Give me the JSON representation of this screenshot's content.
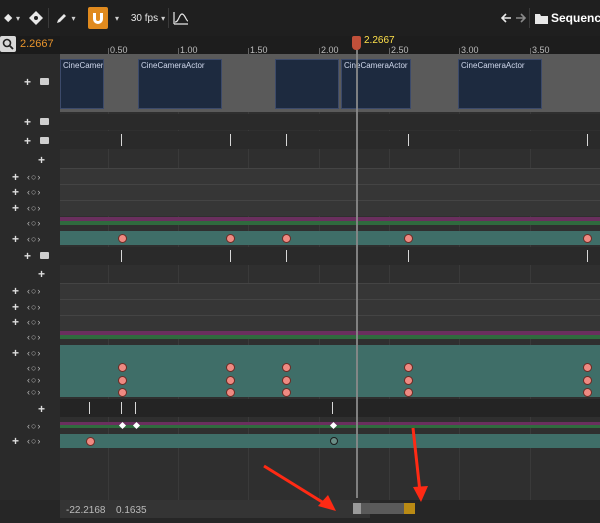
{
  "toolbar": {
    "fps_label": "30 fps",
    "sequence_name": "SequenceM"
  },
  "timeline": {
    "current_time": "2.2667",
    "playhead_time": "2.2667",
    "ticks": [
      "0.50",
      "1.00",
      "1.50",
      "2.00",
      "2.50",
      "3.00",
      "3.50"
    ]
  },
  "camera_clips": [
    "CineCameraActor",
    "CineCameraActor",
    "CineCameraActor",
    "CineCameraActor"
  ],
  "bottom": {
    "view_start": "-22.2168",
    "view_end": "0.1635"
  },
  "colors": {
    "accent_orange": "#e08a1e",
    "playhead_time": "#ffe14a",
    "track_teal": "#3f6e68",
    "track_purple": "#6a2f5e",
    "track_green": "#2f6a3e",
    "key_red": "#ef8a82",
    "annotation_arrow": "#ff2a14"
  }
}
